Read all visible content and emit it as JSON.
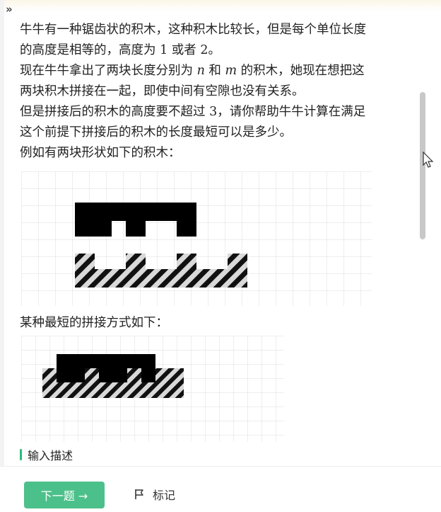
{
  "problem": {
    "p1_a": "牛牛有一种锯齿状的积木，这种积木比较长，但是每个单位长度",
    "p1_b_pre": "的高度是相等的，高度为 ",
    "p1_b_v1": "1",
    "p1_b_mid": " 或者 ",
    "p1_b_v2": "2",
    "p1_b_post": "。",
    "p2_a_pre": "现在牛牛拿出了两块长度分别为 ",
    "p2_a_n": "n",
    "p2_a_mid": " 和 ",
    "p2_a_m": "m",
    "p2_a_post": " 的积木，她现在想把这",
    "p2_b": "两块积木拼接在一起，即使中间有空隙也没有关系。",
    "p3_a_pre": "但是拼接后的积木的高度要不超过 ",
    "p3_a_v": "3",
    "p3_a_post": "，请你帮助牛牛计算在满足",
    "p3_b": "这个前提下拼接后的积木的长度最短可以是多少。",
    "p4": "例如有两块形状如下的积木：",
    "p5": "某种最短的拼接方式如下："
  },
  "section": {
    "input_title": "输入描述"
  },
  "footer": {
    "next_label": "下一题 →",
    "mark_label": "标记"
  },
  "colors": {
    "accent": "#4cc08a",
    "section_bar": "#2bbd7e"
  },
  "icons": {
    "expand": "double-chevron-right-icon",
    "mark": "flag-icon",
    "cursor": "mouse-pointer-icon"
  }
}
